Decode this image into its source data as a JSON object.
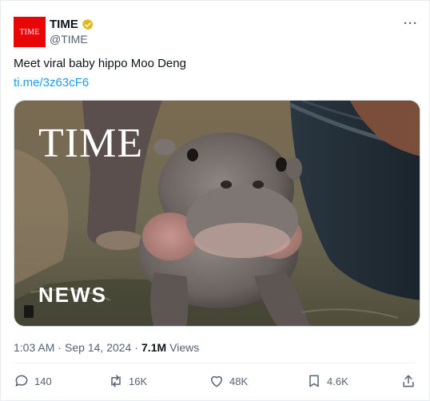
{
  "account": {
    "avatar_text": "TIME",
    "display_name": "TIME",
    "handle": "@TIME",
    "verified_badge": "gold-check-icon"
  },
  "post": {
    "text": "Meet viral baby hippo Moo Deng",
    "link": "ti.me/3z63cF6",
    "media_brand": "TIME",
    "media_label": "NEWS",
    "time": "1:03 AM",
    "separator": "·",
    "date": "Sep 14, 2024",
    "views_count": "7.1M",
    "views_label": "Views"
  },
  "actions": {
    "replies": "140",
    "reposts": "16K",
    "likes": "48K",
    "bookmarks": "4.6K"
  },
  "colors": {
    "brand_red": "#e90606",
    "link_blue": "#1d9bf0",
    "muted": "#536471"
  }
}
